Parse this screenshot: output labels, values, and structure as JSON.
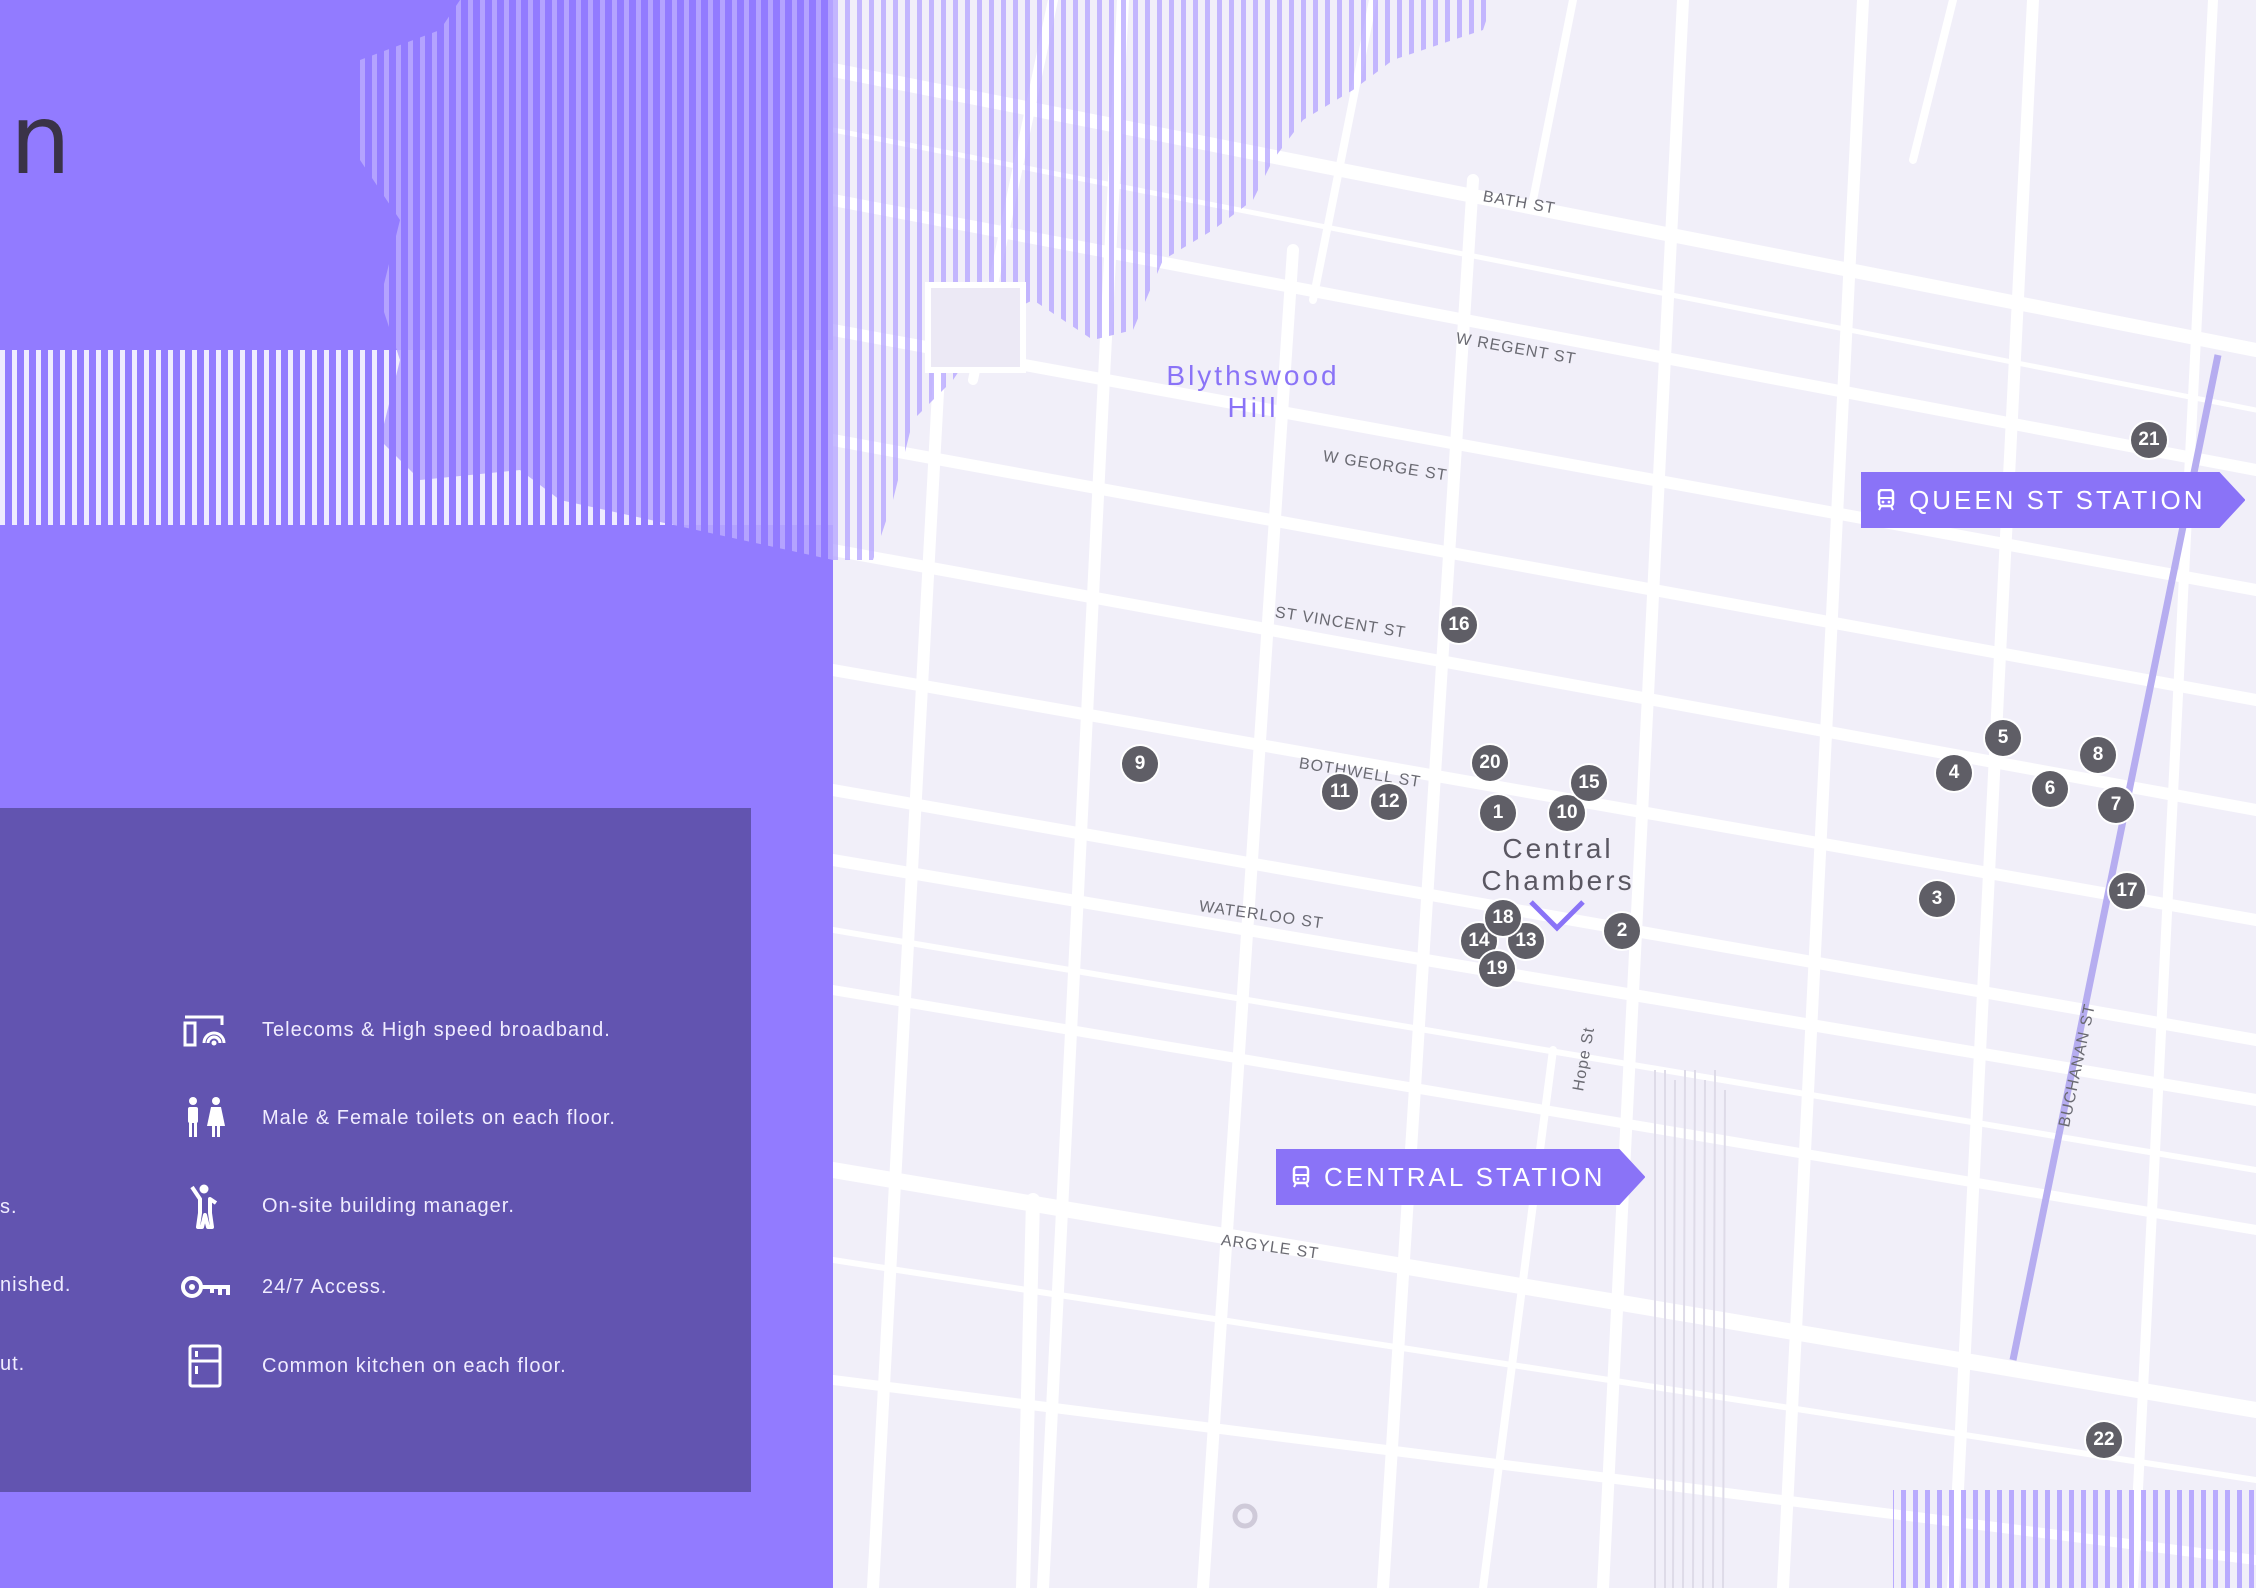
{
  "heading": {
    "text": "n"
  },
  "amenities": [
    {
      "icon": "broadband-icon",
      "label": "Telecoms & High speed broadband."
    },
    {
      "icon": "toilets-icon",
      "label": "Male & Female toilets on each floor."
    },
    {
      "icon": "building-manager-icon",
      "label": "On-site building manager."
    },
    {
      "icon": "key-icon",
      "label": "24/7 Access."
    },
    {
      "icon": "kitchen-icon",
      "label": "Common kitchen on each floor."
    }
  ],
  "amenities_truncated": [
    {
      "label": "s."
    },
    {
      "label": "nished."
    },
    {
      "label": "ut."
    }
  ],
  "map": {
    "district": {
      "line1": "Blythswood",
      "line2": "Hill"
    },
    "landmark": {
      "line1": "Central",
      "line2": "Chambers"
    },
    "stations": [
      {
        "label": "QUEEN ST STATION"
      },
      {
        "label": "CENTRAL STATION"
      }
    ],
    "streets": [
      "BATH ST",
      "W REGENT ST",
      "W GEORGE ST",
      "ST VINCENT ST",
      "BOTHWELL ST",
      "WATERLOO ST",
      "ARGYLE ST",
      "Hope St",
      "BUCHANAN ST"
    ],
    "markers": [
      "1",
      "2",
      "3",
      "4",
      "5",
      "6",
      "7",
      "8",
      "9",
      "10",
      "11",
      "12",
      "13",
      "14",
      "15",
      "16",
      "17",
      "18",
      "19",
      "20",
      "21",
      "22"
    ]
  },
  "colors": {
    "panel": "#927bff",
    "amenity_box": "#6254b0",
    "accent": "#8a73f7",
    "map_bg": "#f1eff9",
    "marker": "#5f5e66"
  }
}
